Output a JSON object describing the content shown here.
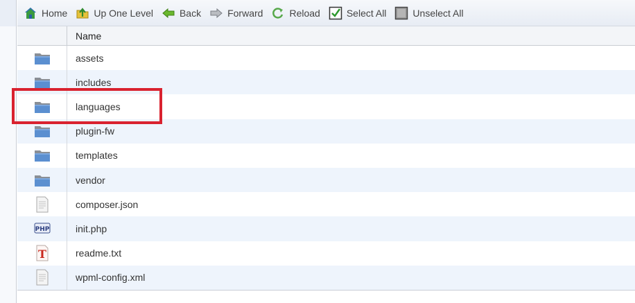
{
  "toolbar": {
    "buttons": [
      {
        "label": "Home",
        "icon": "home-icon"
      },
      {
        "label": "Up One Level",
        "icon": "up-level-icon"
      },
      {
        "label": "Back",
        "icon": "back-arrow-icon"
      },
      {
        "label": "Forward",
        "icon": "forward-arrow-icon"
      },
      {
        "label": "Reload",
        "icon": "reload-icon"
      },
      {
        "label": "Select All",
        "icon": "checkbox-checked-icon"
      },
      {
        "label": "Unselect All",
        "icon": "checkbox-unchecked-icon"
      }
    ]
  },
  "table": {
    "columns": [
      "",
      "Name"
    ],
    "rows": [
      {
        "name": "assets",
        "type": "folder",
        "icon": "folder-icon"
      },
      {
        "name": "includes",
        "type": "folder",
        "icon": "folder-icon"
      },
      {
        "name": "languages",
        "type": "folder",
        "icon": "folder-icon"
      },
      {
        "name": "plugin-fw",
        "type": "folder",
        "icon": "folder-icon"
      },
      {
        "name": "templates",
        "type": "folder",
        "icon": "folder-icon"
      },
      {
        "name": "vendor",
        "type": "folder",
        "icon": "folder-icon"
      },
      {
        "name": "composer.json",
        "type": "file",
        "icon": "generic-file-icon"
      },
      {
        "name": "init.php",
        "type": "php",
        "icon": "php-file-icon"
      },
      {
        "name": "readme.txt",
        "type": "text",
        "icon": "text-file-icon"
      },
      {
        "name": "wpml-config.xml",
        "type": "file",
        "icon": "generic-file-icon"
      }
    ]
  },
  "colors": {
    "row_alt": "#eef4fc",
    "highlight": "#d9222f",
    "folder": "#5b8fd0"
  },
  "highlighted_row": "languages"
}
